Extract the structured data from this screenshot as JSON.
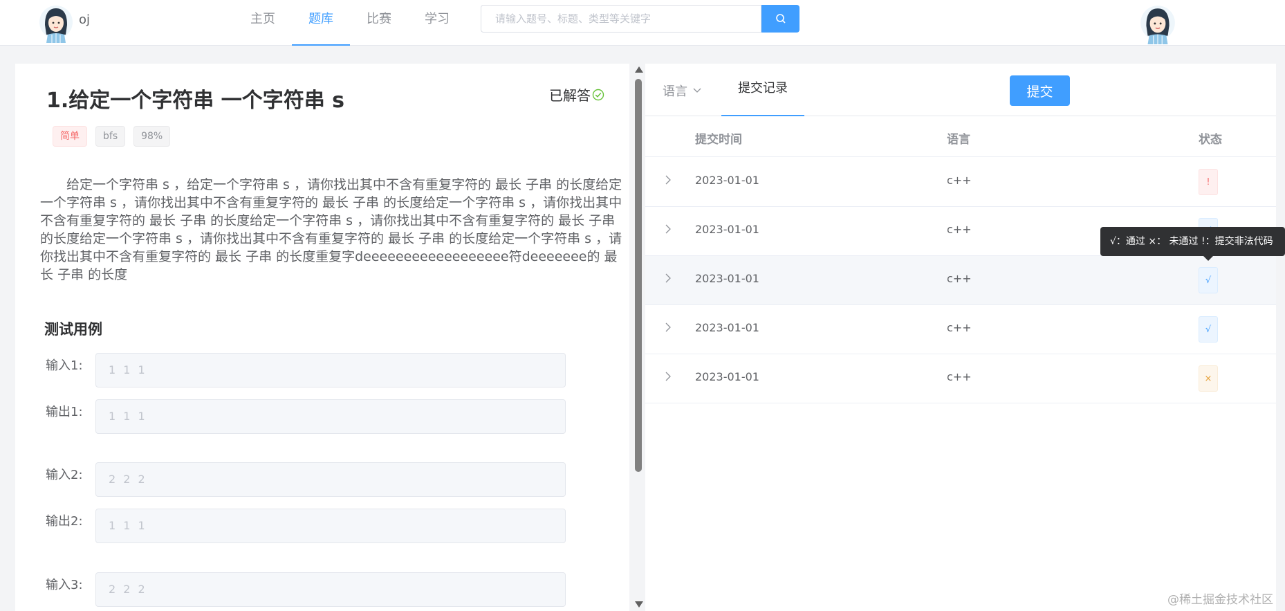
{
  "header": {
    "brand": "oj",
    "nav": [
      "主页",
      "题库",
      "比赛",
      "学习"
    ],
    "active_nav": 1,
    "search_placeholder": "请输入题号、标题、类型等关键字"
  },
  "problem": {
    "title": "1.给定一个字符串 一个字符串 s",
    "status": "已解答",
    "tags": [
      "简单",
      "bfs",
      "98%"
    ],
    "description": "给定一个字符串 s ，给定一个字符串 s ，请你找出其中不含有重复字符的 最长 子串 的长度给定一个字符串 s ，请你找出其中不含有重复字符的 最长 子串 的长度给定一个字符串 s ，请你找出其中不含有重复字符的 最长 子串 的长度给定一个字符串 s ，请你找出其中不含有重复字符的 最长 子串 的长度给定一个字符串 s ，请你找出其中不含有重复字符的 最长 子串 的长度给定一个字符串 s ，请你找出其中不含有重复字符的 最长 子串 的长度重复字deeeeeeeeeeeeeeeeee符deeeeeee的 最长 子串 的长度",
    "test_section_title": "测试用例",
    "test_cases": [
      {
        "label": "输入1:",
        "value": "1 1 1"
      },
      {
        "label": "输出1:",
        "value": "1 1 1"
      },
      {
        "label": "输入2:",
        "value": "2 2 2"
      },
      {
        "label": "输出2:",
        "value": "1 1 1"
      },
      {
        "label": "输入3:",
        "value": "2 2 2"
      }
    ]
  },
  "right": {
    "tab_language": "语言",
    "tab_records": "提交记录",
    "submit_label": "提交",
    "columns": [
      "提交时间",
      "语言",
      "状态"
    ],
    "rows": [
      {
        "time": "2023-01-01",
        "lang": "c++",
        "status": "!"
      },
      {
        "time": "2023-01-01",
        "lang": "c++",
        "status": "√"
      },
      {
        "time": "2023-01-01",
        "lang": "c++",
        "status": "√"
      },
      {
        "time": "2023-01-01",
        "lang": "c++",
        "status": "√"
      },
      {
        "time": "2023-01-01",
        "lang": "c++",
        "status": "×"
      }
    ],
    "tooltip": "√：通过 ×： 未通过 !：提交非法代码"
  },
  "watermark": "@稀土掘金技术社区",
  "colors": {
    "primary": "#409eff",
    "danger": "#f56c6c",
    "warning": "#e6a23c",
    "success": "#67c23a"
  }
}
